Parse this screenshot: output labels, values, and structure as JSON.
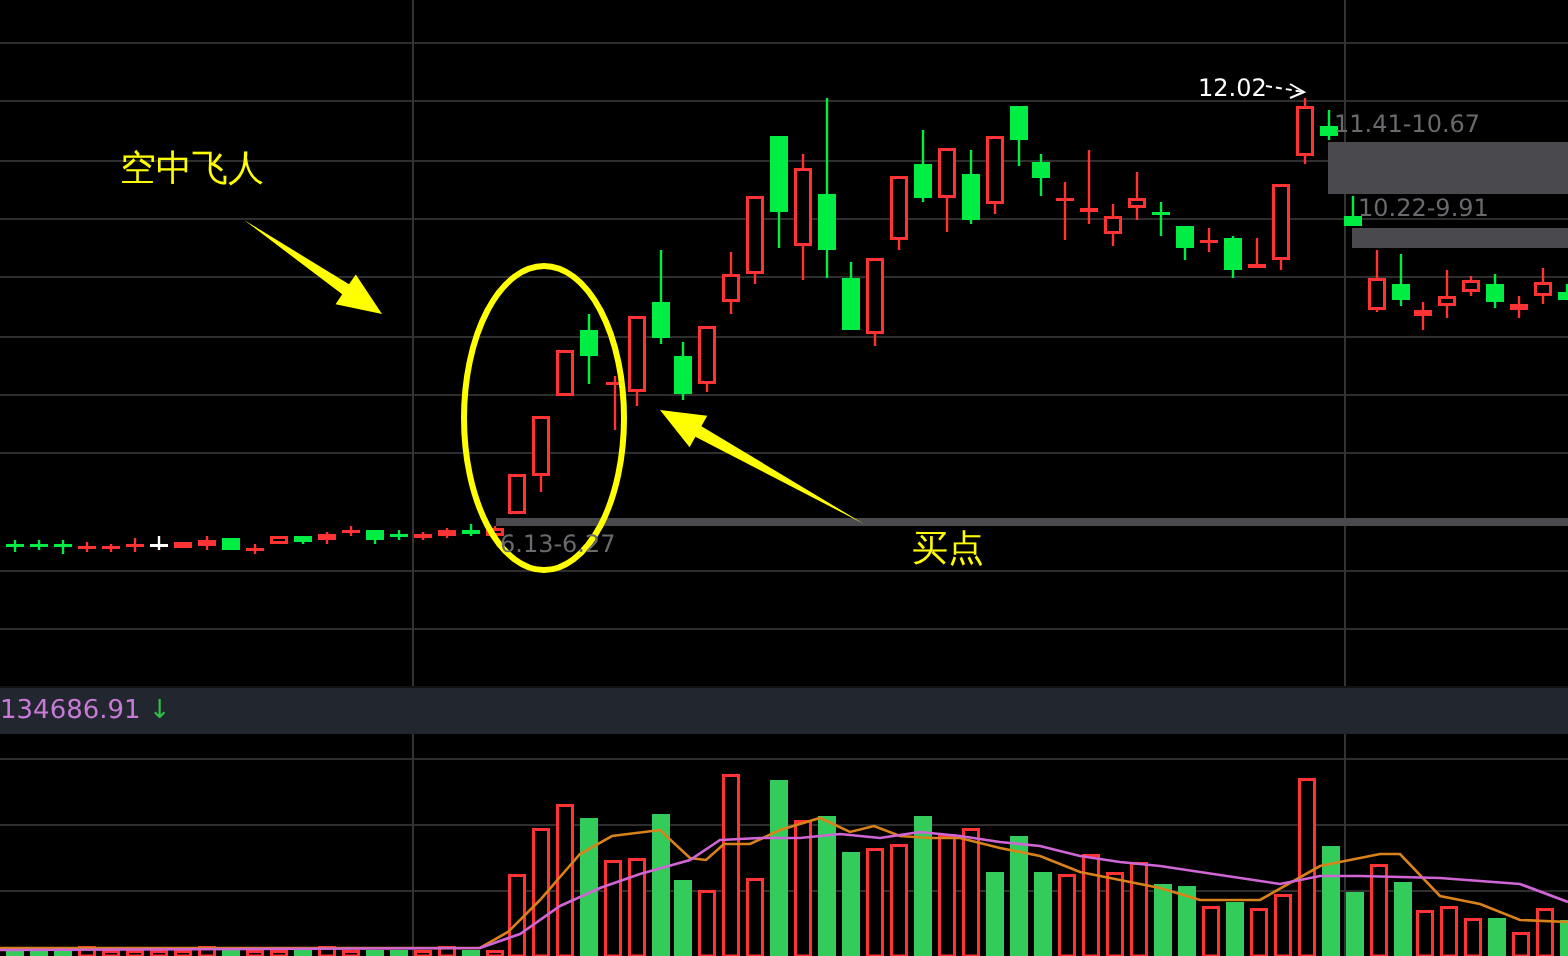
{
  "annotations": [
    {
      "kind": "pattern_label",
      "text": "空中飞人"
    },
    {
      "kind": "buy_label",
      "text": "买点"
    }
  ],
  "price_labels": [
    {
      "kind": "peak",
      "text": "12.02"
    },
    {
      "kind": "gap",
      "text": "11.41-10.67"
    },
    {
      "kind": "gap",
      "text": "10.22-9.91"
    },
    {
      "kind": "gap",
      "text": "6.13-6.27"
    }
  ],
  "volume_bar": {
    "value": "134686.91",
    "arrow": "↓"
  }
}
